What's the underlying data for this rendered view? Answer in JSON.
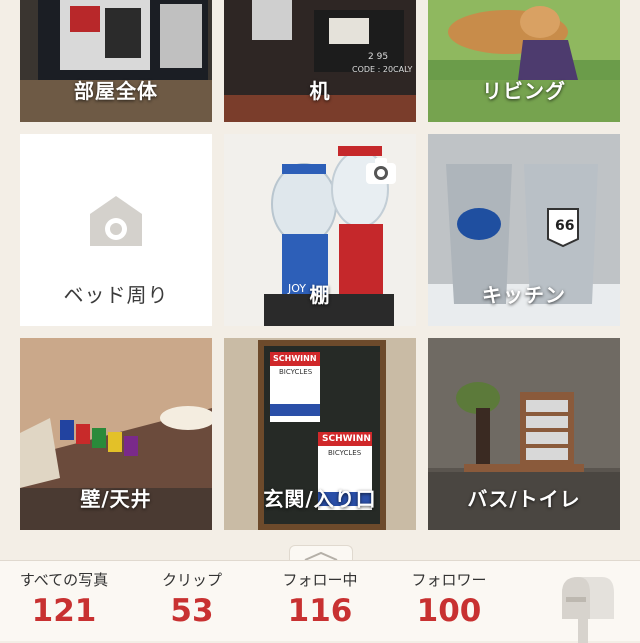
{
  "rooms": [
    {
      "label": "部屋全体"
    },
    {
      "label": "机"
    },
    {
      "label": "リビング"
    },
    {
      "label": "ベッド周り"
    },
    {
      "label": "棚"
    },
    {
      "label": "キッチン"
    },
    {
      "label": "壁/天井"
    },
    {
      "label": "玄関/入り口"
    },
    {
      "label": "バス/トイレ"
    }
  ],
  "photo_text": {
    "desk_code": "2 95",
    "desk_code2": "CODE : 20CALY",
    "jar_text": "JOY",
    "tumbler_badge": "66",
    "bike_brand_1": "SCHWINN",
    "bike_sub_1": "BICYCLES",
    "bike_brand_2": "SCHWINN",
    "bike_sub_2": "BICYCLES"
  },
  "stats": [
    {
      "label": "すべての写真",
      "value": "121"
    },
    {
      "label": "クリップ",
      "value": "53"
    },
    {
      "label": "フォロー中",
      "value": "116"
    },
    {
      "label": "フォロワー",
      "value": "100"
    }
  ],
  "icons": {
    "camera": "camera-icon",
    "chevron": "chevron-up-icon",
    "mailbox": "mailbox-icon"
  },
  "colors": {
    "accent": "#c83131",
    "background": "#f3eee6"
  }
}
